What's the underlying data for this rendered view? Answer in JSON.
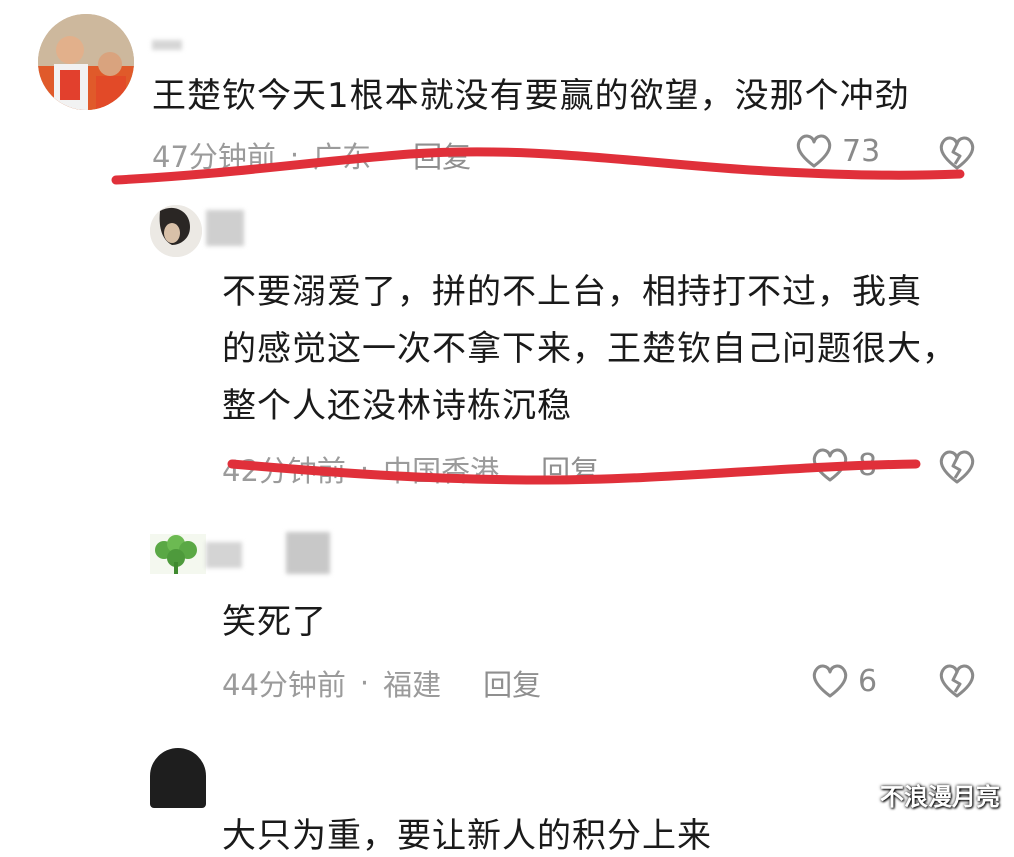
{
  "comments": [
    {
      "text": "王楚钦今天1根本就没有要赢的欲望，没那个冲劲",
      "time": "47分钟前",
      "location": "广东",
      "reply_label": "回复",
      "likes": "73"
    },
    {
      "text": "不要溺爱了，拼的不上台，相持打不过，我真\n的感觉这一次不拿下来，王楚钦自己问题很大，\n整个人还没林诗栋沉稳",
      "time": "42分钟前",
      "location": "中国香港",
      "reply_label": "回复",
      "likes": "8"
    },
    {
      "text": "笑死了",
      "time": "44分钟前",
      "location": "福建",
      "reply_label": "回复",
      "likes": "6"
    },
    {
      "text": "大只为重，要让新人的积分上来"
    }
  ],
  "watermark": "不浪漫月亮",
  "colors": {
    "underline": "#e0303a",
    "meta_text": "#9b9b9b"
  }
}
